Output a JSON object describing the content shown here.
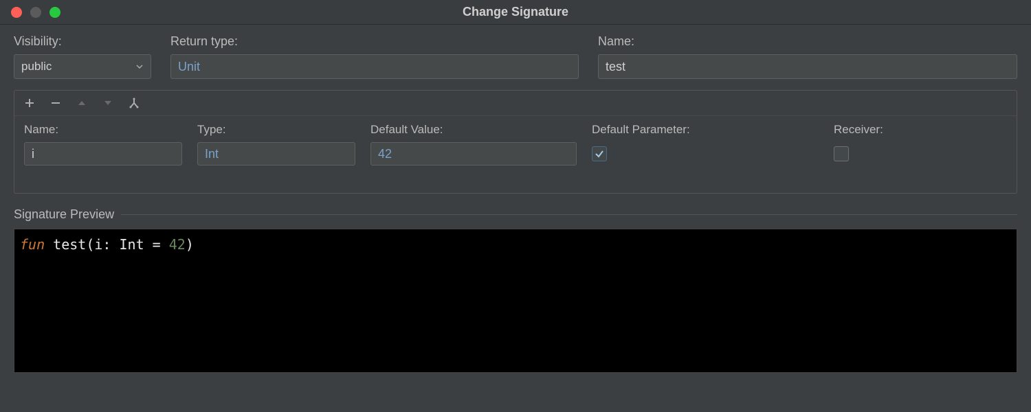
{
  "window": {
    "title": "Change Signature"
  },
  "labels": {
    "visibility": "Visibility:",
    "return_type": "Return type:",
    "name": "Name:",
    "signature_preview": "Signature Preview"
  },
  "fields": {
    "visibility": "public",
    "return_type": "Unit",
    "name": "test"
  },
  "params_panel": {
    "headers": {
      "name": "Name:",
      "type": "Type:",
      "default_value": "Default Value:",
      "default_parameter": "Default Parameter:",
      "receiver": "Receiver:"
    },
    "rows": [
      {
        "name": "i",
        "type": "Int",
        "default_value": "42",
        "default_parameter": true,
        "receiver": false
      }
    ]
  },
  "preview": {
    "keyword": "fun",
    "text_head": " test(i: Int = ",
    "number": "42",
    "text_tail": ")"
  },
  "icons": {
    "add": "plus-icon",
    "remove": "minus-icon",
    "up": "arrow-up-icon",
    "down": "arrow-down-icon",
    "fork": "fork-icon",
    "chevron": "chevron-down-icon"
  }
}
